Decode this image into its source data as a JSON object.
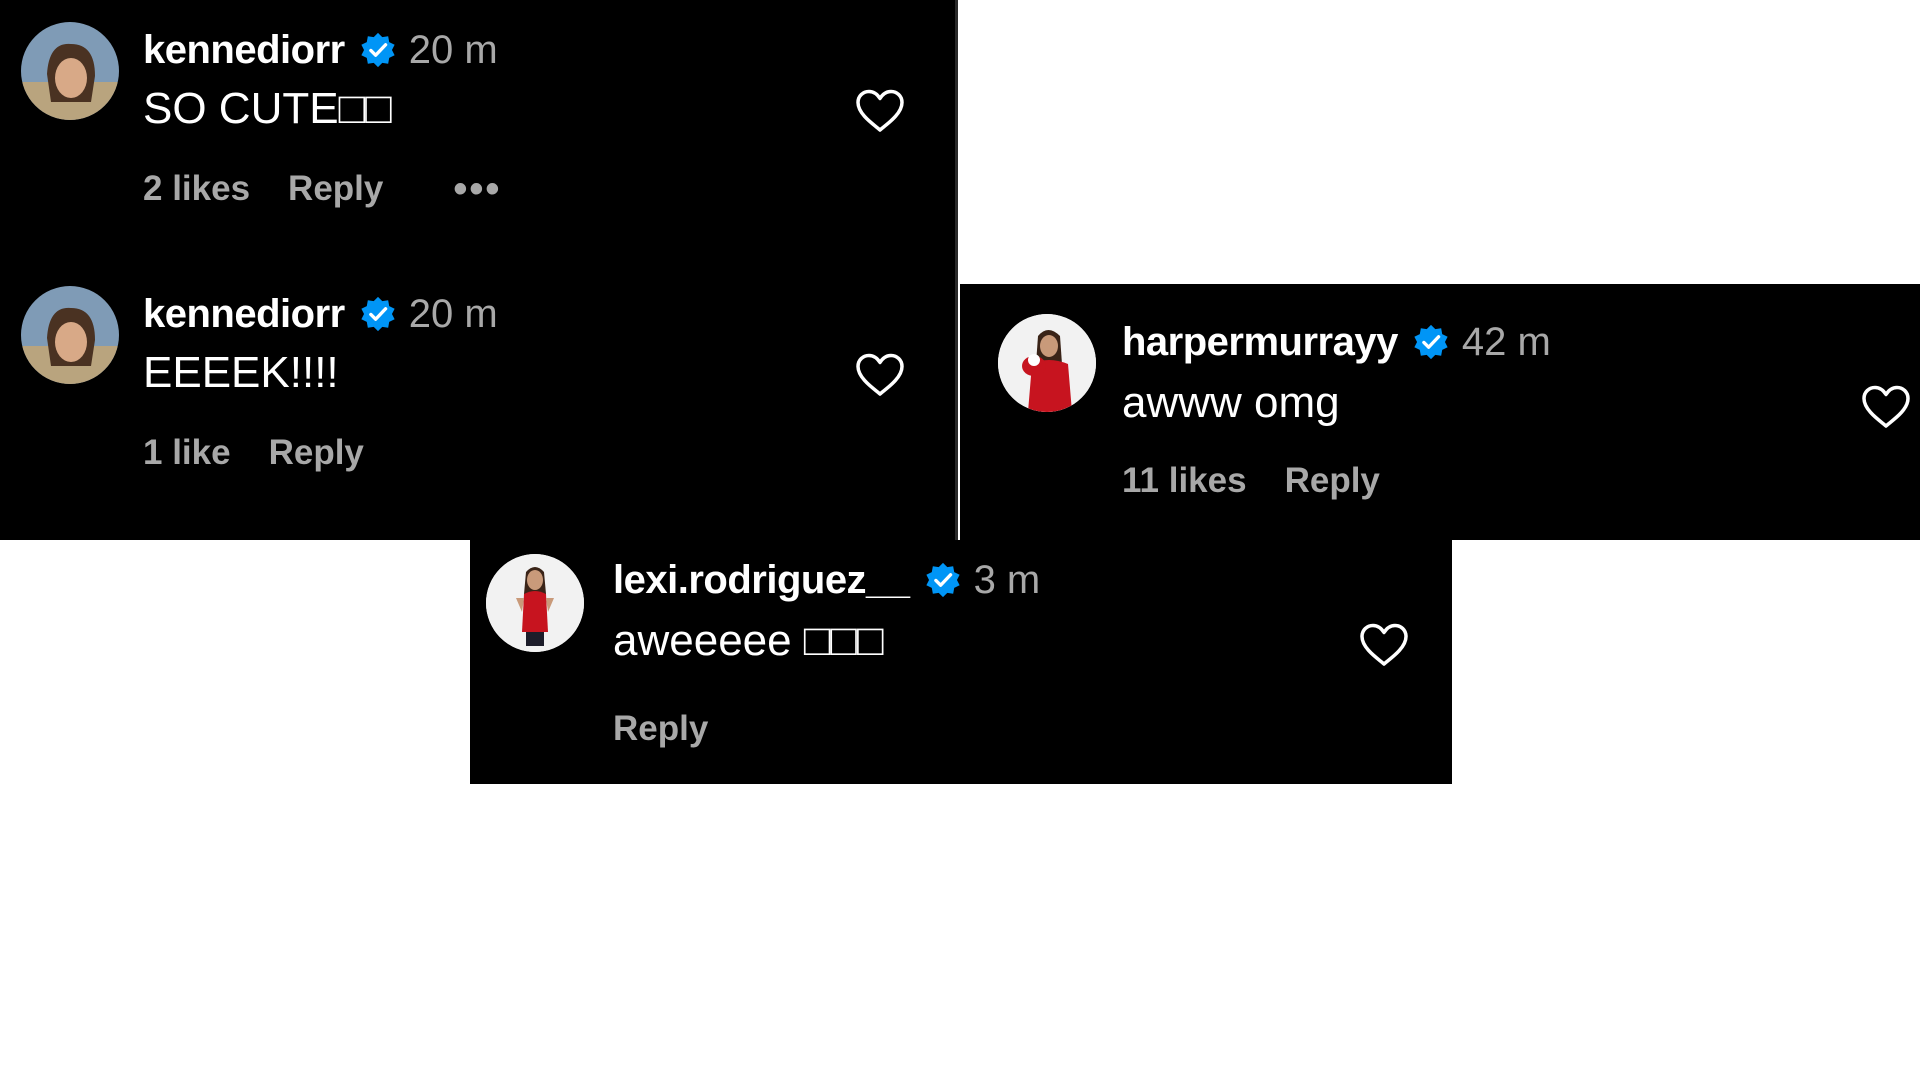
{
  "comments": [
    {
      "username": "kennediorr",
      "time": "20 m",
      "text": "SO CUTE□□",
      "likes": "2 likes",
      "reply": "Reply",
      "more": "•••",
      "verified": true
    },
    {
      "username": "kennediorr",
      "time": "20 m",
      "text": "EEEEK!!!!",
      "likes": "1 like",
      "reply": "Reply",
      "verified": true
    },
    {
      "username": "harpermurrayy",
      "time": "42 m",
      "text": "awww omg",
      "likes": "11 likes",
      "reply": "Reply",
      "verified": true
    },
    {
      "username": "lexi.rodriguez__",
      "time": "3 m",
      "text": "aweeeee □□□",
      "reply": "Reply",
      "verified": true
    }
  ],
  "icons": {
    "verified": "verified-badge-icon",
    "like": "heart-outline-icon"
  },
  "colors": {
    "background": "#000000",
    "text": "#ffffff",
    "secondary": "#a8a8a8",
    "verified": "#0095f6"
  }
}
